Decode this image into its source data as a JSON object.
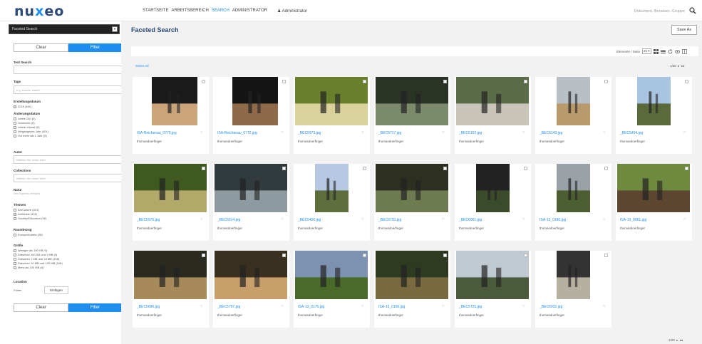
{
  "app": {
    "logo": "nuxeo"
  },
  "nav": {
    "items": [
      "STARTSEITE",
      "ARBEITSBEREICH",
      "SEARCH",
      "ADMINISTRATOR"
    ],
    "user": "Administrator",
    "search_placeholder": "Dokument, Benutzer, Gruppe"
  },
  "sidebar": {
    "search_select": "Faceted Search",
    "clear_label": "Clear",
    "filter_label": "Filter",
    "text_search_label": "Text Search",
    "tags_label": "Tags",
    "tags_placeholder": "e.g. events, leader",
    "created_label": "Erstellungsdatum",
    "created_opts": [
      "2015 (401)"
    ],
    "modified_label": "Änderungsdatum",
    "modified_opts": [
      "Letzte 24h (0)",
      "Vorwoche (0)",
      "Letzter Monat (0)",
      "Vergangenes Jahr (401)",
      "Vor mehr als 1 Jahr (0)"
    ],
    "author_label": "Autor",
    "author_placeholder": "Wählen Sie einen Wert",
    "collections_label": "Collections",
    "collections_placeholder": "Wählen Sie einen Wert",
    "nature_label": "Natur",
    "nature_hint": "Kein Ergebnis verfügbar",
    "themes_label": "Themen",
    "themes_opts": [
      "Art/Culture (401)",
      "Art/Music (401)",
      "Society/Education (52)"
    ],
    "space_label": "Raumbezug",
    "space_opts": [
      "Europe/Austria (28)"
    ],
    "size_label": "Größe",
    "size_opts": [
      "Weniger als 100 KB (0)",
      "Zwischen 100 KB und 1 MB (0)",
      "Zwischen 1 MB und 10 MB (348)",
      "Zwischen 10 MB und 100 MB (106)",
      "Mehr als 100 MB (0)"
    ],
    "location_label": "Location",
    "folder_label": "Folder",
    "insert_label": "Einfügen"
  },
  "main": {
    "title": "Faceted Search",
    "save_as": "Save As",
    "per_page": "Elemente / Seite",
    "per_page_value": "20",
    "select_all": "Select All",
    "pager": "1/20",
    "cards": [
      {
        "name": "ISA-Reichenau_0770.jpg",
        "author": "thomasdoerfinger"
      },
      {
        "name": "ISA-Reichenau_0772.jpg",
        "author": "thomasdoerfinger"
      },
      {
        "name": "_BEC5973.jpg",
        "author": "thomasdoerfinger"
      },
      {
        "name": "_BEC6717.jpg",
        "author": "thomasdoerfinger"
      },
      {
        "name": "_BEC6152.jpg",
        "author": "thomasdoerfinger"
      },
      {
        "name": "_BEC6143.jpg",
        "author": "thomasdoerfinger"
      },
      {
        "name": "_BEC5454.jpg",
        "author": "thomasdoerfinger"
      },
      {
        "name": "_BEC5976.jpg",
        "author": "thomasdoerfinger"
      },
      {
        "name": "_BEC6914.jpg",
        "author": "thomasdoerfinger"
      },
      {
        "name": "_BEC5450.jpg",
        "author": "thomasdoerfinger"
      },
      {
        "name": "_BEC6720.jpg",
        "author": "thomasdoerfinger"
      },
      {
        "name": "_BEC6061.jpg",
        "author": "thomasdoerfinger"
      },
      {
        "name": "ISA-13_0196.jpg",
        "author": "thomasdoerfinger"
      },
      {
        "name": "ISA-13_0061.jpg",
        "author": "thomasdoerfinger"
      },
      {
        "name": "_BEC5696.jpg",
        "author": "thomasdoerfinger"
      },
      {
        "name": "_BEC5797.jpg",
        "author": "thomasdoerfinger"
      },
      {
        "name": "ISA-13_0176.jpg",
        "author": "thomasdoerfinger"
      },
      {
        "name": "ISA-13_0156.jpg",
        "author": "thomasdoerfinger"
      },
      {
        "name": "_BEC5725.jpg",
        "author": "thomasdoerfinger"
      },
      {
        "name": "_BEC6932.jpg",
        "author": "thomasdoerfinger"
      }
    ]
  },
  "colors": {
    "accent": "#1e8ef0",
    "title": "#2b4a77"
  }
}
